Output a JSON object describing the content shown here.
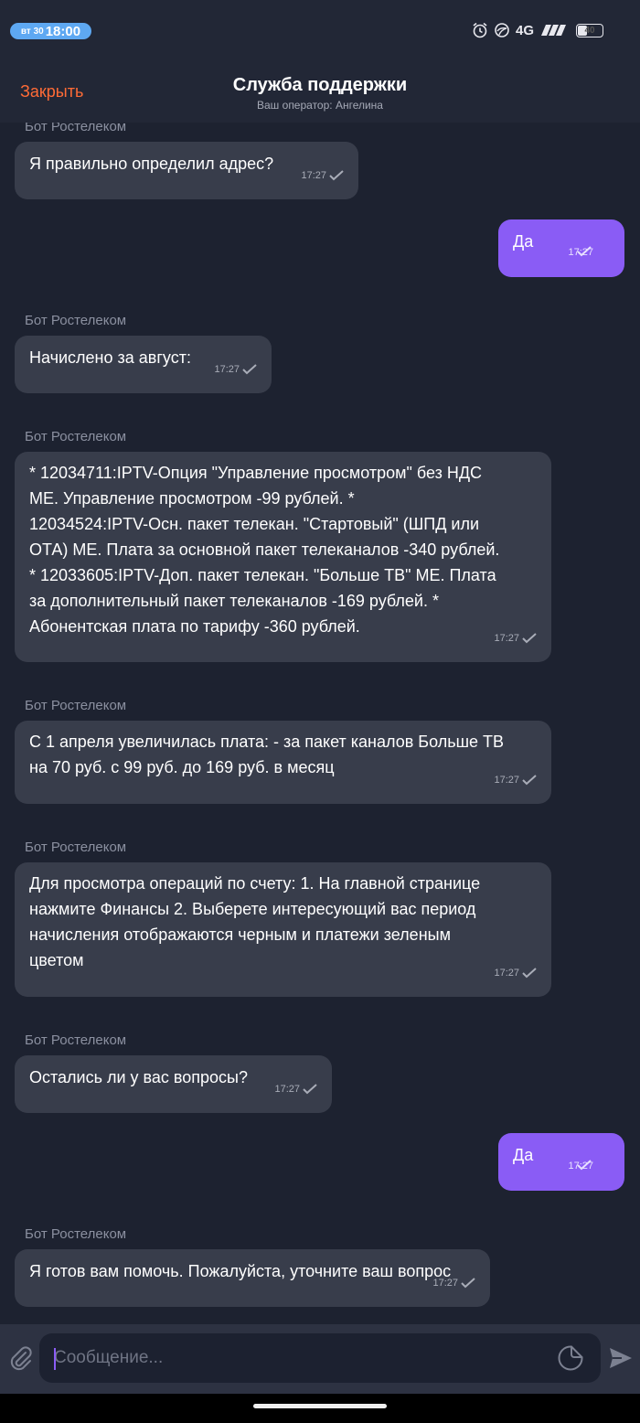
{
  "status_bar": {
    "day": "вт 30",
    "time": "18:00",
    "network": "4G",
    "battery": "40",
    "battery_level": 0.4,
    "icons": [
      "alarm-icon",
      "data-saver-icon",
      "signal-icon",
      "signal-icon",
      "battery-icon"
    ]
  },
  "header": {
    "close_label": "Закрыть",
    "title": "Служба поддержки",
    "subtitle": "Ваш оператор: Ангелина"
  },
  "messages": [
    {
      "direction": "in",
      "sender": "Бот Ростелеком",
      "text": "Я правильно определил адрес?",
      "time": "17:27"
    },
    {
      "direction": "out",
      "text": "Да",
      "time": "17:27"
    },
    {
      "direction": "in",
      "sender": "Бот Ростелеком",
      "text": "Начислено за август:",
      "time": "17:27"
    },
    {
      "direction": "in",
      "sender": "Бот Ростелеком",
      "lines": [
        "* 12034711:IPTV-Опция \"Управление просмотром\" без НДС",
        "МЕ. Управление просмотром -99 рублей. *",
        "12034524:IPTV-Осн. пакет телекан. \"Стартовый\" (ШПД или",
        "ОТА) МЕ. Плата за основной пакет телеканалов -340 рублей.",
        "* 12033605:IPTV-Доп. пакет телекан. \"Больше ТВ\" МЕ. Плата",
        "за дополнительный пакет телеканалов -169 рублей. *",
        "Абонентская плата по тарифу -360 рублей."
      ],
      "time": "17:27"
    },
    {
      "direction": "in",
      "sender": "Бот Ростелеком",
      "lines": [
        "С 1 апреля увеличилась плата: - за пакет каналов Больше ТВ",
        "на 70 руб. с 99 руб. до 169 руб. в месяц"
      ],
      "time": "17:27"
    },
    {
      "direction": "in",
      "sender": "Бот Ростелеком",
      "lines": [
        "Для просмотра операций по счету: 1. На главной странице",
        "нажмите Финансы 2. Выберете интересующий вас период",
        "начисления отображаются черным и платежи зеленым",
        "цветом"
      ],
      "time": "17:27"
    },
    {
      "direction": "in",
      "sender": "Бот Ростелеком",
      "text": "Остались ли у вас вопросы?",
      "time": "17:27"
    },
    {
      "direction": "out",
      "text": "Да",
      "time": "17:27"
    },
    {
      "direction": "in",
      "sender": "Бот Ростелеком",
      "text": "Я готов вам помочь. Пожалуйста, уточните ваш вопрос",
      "time": "17:27"
    }
  ],
  "composer": {
    "placeholder": "Сообщение...",
    "attach_icon": "paperclip-icon",
    "sticker_icon": "sticker-icon",
    "send_icon": "send-icon"
  },
  "colors": {
    "background": "#1d2230",
    "incoming_bubble": "#383d4b",
    "outgoing_bubble": "#8a5cf5",
    "accent_close": "#ff6b36",
    "time_pill": "#5ea8f2"
  }
}
